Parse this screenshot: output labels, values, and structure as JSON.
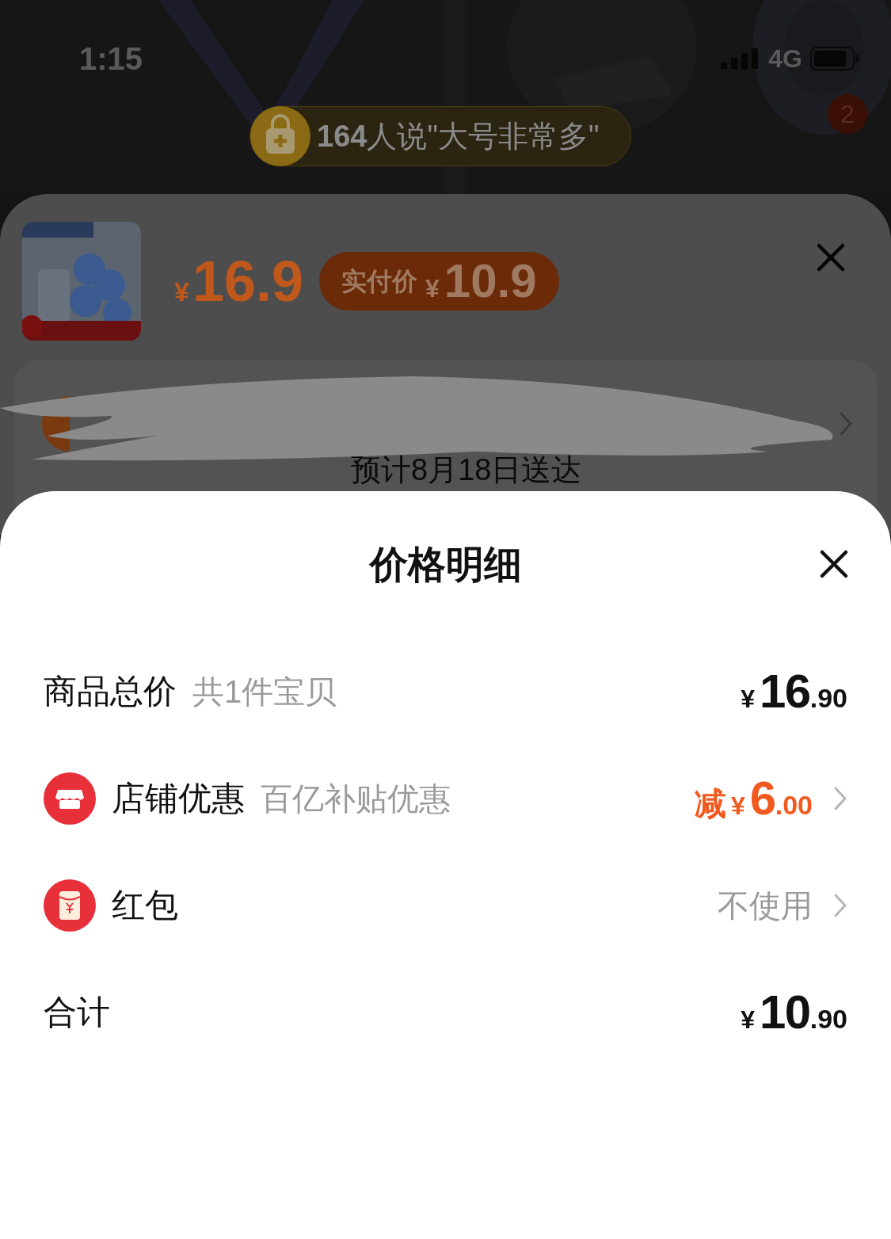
{
  "status_bar": {
    "time": "1:15",
    "network": "4G"
  },
  "banner": {
    "text": "**164**人说\"大号非常多\"",
    "badge": "2"
  },
  "product": {
    "price_symbol": "¥",
    "price": "16.9",
    "pay_label": "实付价",
    "pay_symbol": "¥",
    "pay_price": "10.9"
  },
  "delivery": {
    "text": "预计8月18日送达"
  },
  "sheet": {
    "title": "价格明细",
    "rows": [
      {
        "kind": "total",
        "label": "商品总价",
        "note": "共1件宝贝",
        "arrow": false,
        "prefix": "",
        "symbol": "¥",
        "integer": "16",
        "decimals": ".90"
      },
      {
        "kind": "discount",
        "label": "店铺优惠",
        "note": "百亿补贴优惠",
        "arrow": true,
        "prefix": "减",
        "symbol": "¥",
        "integer": "6",
        "decimals": ".00"
      },
      {
        "kind": "envelope",
        "label": "红包",
        "arrow": true,
        "value": "不使用"
      },
      {
        "kind": "sum",
        "label": "合计",
        "arrow": false,
        "symbol": "¥",
        "integer": "10",
        "decimals": ".90"
      }
    ]
  }
}
